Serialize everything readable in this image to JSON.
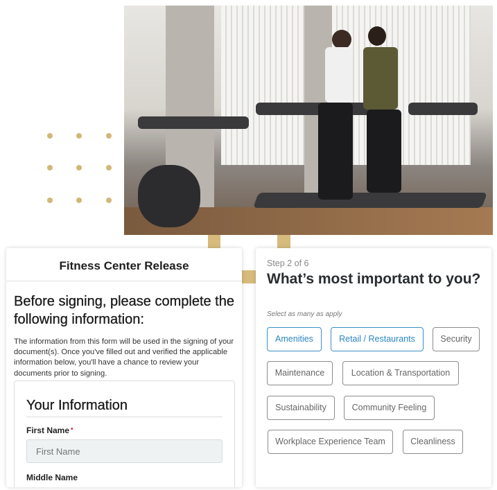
{
  "colors": {
    "accent_gold": "#d6bb7c",
    "selected_blue": "#2a86c3",
    "required_red": "#e0233a"
  },
  "photo": {
    "icon": "gym-treadmill-photo"
  },
  "release_form": {
    "title": "Fitness Center Release",
    "heading": "Before signing, please complete the following information:",
    "description": "The information from this form will be used in the signing of your document(s). Once you've filled out and verified the applicable information below, you'll have a chance to review your documents prior to signing.",
    "section_title": "Your Information",
    "first_name_label": "First Name",
    "required_marker": "•",
    "first_name_placeholder": "First Name",
    "first_name_value": "",
    "middle_name_label": "Middle Name"
  },
  "survey": {
    "step": "Step 2 of 6",
    "question": "What’s most important to you?",
    "hint": "Select as many as apply",
    "options": [
      {
        "label": "Amenities",
        "selected": true
      },
      {
        "label": "Retail / Restaurants",
        "selected": true
      },
      {
        "label": "Security",
        "selected": false
      },
      {
        "label": "Maintenance",
        "selected": false
      },
      {
        "label": "Location & Transportation",
        "selected": false
      },
      {
        "label": "Sustainability",
        "selected": false
      },
      {
        "label": "Community Feeling",
        "selected": false
      },
      {
        "label": "Workplace Experience Team",
        "selected": false
      },
      {
        "label": "Cleanliness",
        "selected": false
      }
    ]
  }
}
